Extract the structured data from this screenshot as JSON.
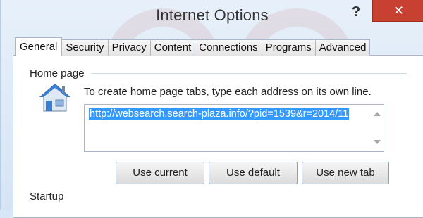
{
  "window": {
    "title": "Internet Options",
    "help_label": "?",
    "close_label": "✕"
  },
  "tabs": [
    {
      "label": "General"
    },
    {
      "label": "Security"
    },
    {
      "label": "Privacy"
    },
    {
      "label": "Content"
    },
    {
      "label": "Connections"
    },
    {
      "label": "Programs"
    },
    {
      "label": "Advanced"
    }
  ],
  "active_tab": "General",
  "home_page": {
    "section_label": "Home page",
    "instruction": "To create home page tabs, type each address on its own line.",
    "url_value": "http://websearch.search-plaza.info/?pid=1539&r=2014/11"
  },
  "buttons": {
    "use_current": "Use current",
    "use_default": "Use default",
    "use_new_tab": "Use new tab"
  },
  "startup": {
    "section_label": "Startup"
  },
  "icons": {
    "house": "house-icon",
    "help": "help-icon",
    "close": "close-icon"
  },
  "colors": {
    "selection": "#3399ff",
    "close_button": "#c84031",
    "house_blue": "#3b7fd4"
  }
}
